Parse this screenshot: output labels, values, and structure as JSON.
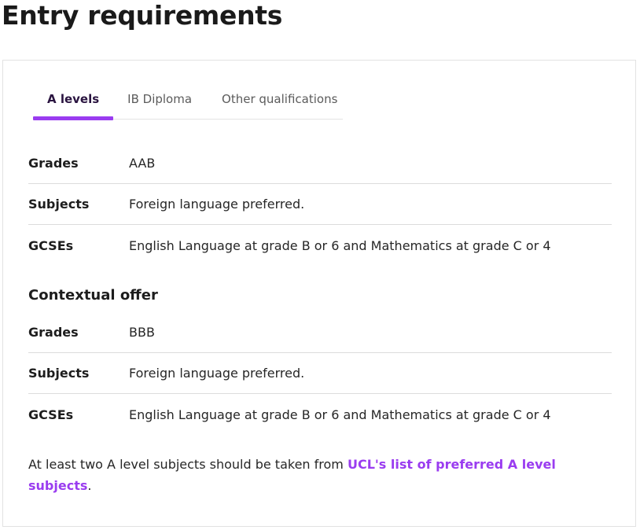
{
  "page": {
    "title": "Entry requirements"
  },
  "colors": {
    "accent": "#9a3cf0",
    "active_tab_text": "#2a1440",
    "divider": "#dcdcdc"
  },
  "tabs": [
    {
      "label": "A levels",
      "active": true
    },
    {
      "label": "IB Diploma",
      "active": false
    },
    {
      "label": "Other qualifications",
      "active": false
    }
  ],
  "standard_offer": {
    "rows": [
      {
        "label": "Grades",
        "value": "AAB"
      },
      {
        "label": "Subjects",
        "value": "Foreign language preferred."
      },
      {
        "label": "GCSEs",
        "value": "English Language at grade B or 6 and Mathematics at grade C or 4"
      }
    ]
  },
  "contextual_offer": {
    "heading": "Contextual offer",
    "rows": [
      {
        "label": "Grades",
        "value": "BBB"
      },
      {
        "label": "Subjects",
        "value": "Foreign language preferred."
      },
      {
        "label": "GCSEs",
        "value": "English Language at grade B or 6 and Mathematics at grade C or 4"
      }
    ]
  },
  "note": {
    "text_before": "At least two A level subjects should be taken from ",
    "link_text": "UCL's list of preferred A level subjects",
    "text_after": "."
  }
}
